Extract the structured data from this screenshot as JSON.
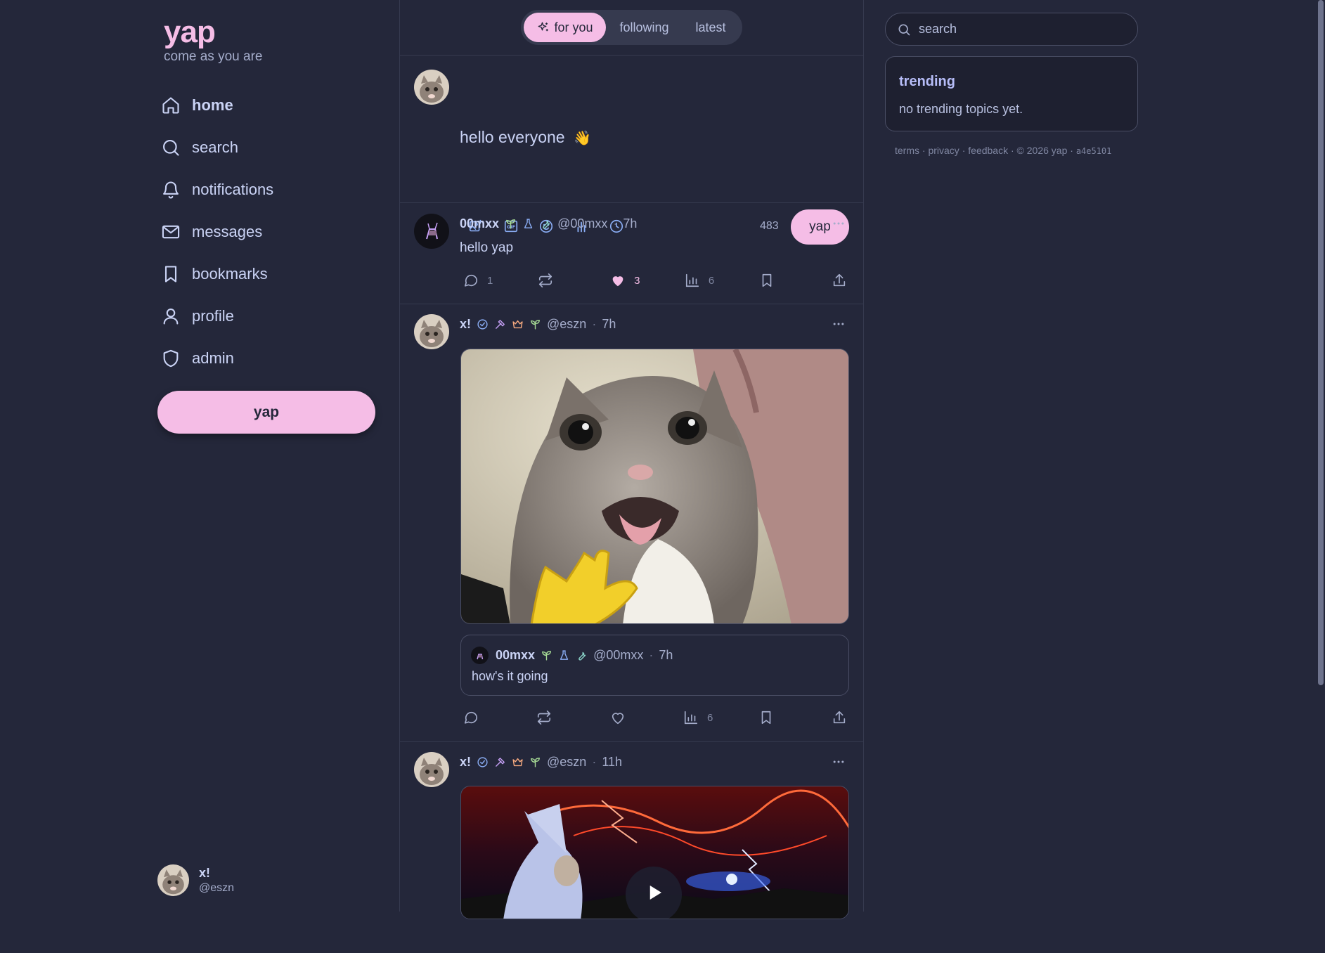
{
  "brand": {
    "logo": "yap",
    "tagline": "come as you are"
  },
  "nav": {
    "items": [
      {
        "label": "home",
        "icon": "home-icon"
      },
      {
        "label": "search",
        "icon": "search-icon"
      },
      {
        "label": "notifications",
        "icon": "bell-icon"
      },
      {
        "label": "messages",
        "icon": "mail-icon"
      },
      {
        "label": "bookmarks",
        "icon": "bookmark-icon"
      },
      {
        "label": "profile",
        "icon": "user-icon"
      },
      {
        "label": "admin",
        "icon": "shield-icon"
      }
    ],
    "yap_button": "yap"
  },
  "me": {
    "name": "x!",
    "handle": "@eszn"
  },
  "feed_tabs": [
    {
      "label": "for you",
      "active": true
    },
    {
      "label": "following",
      "active": false
    },
    {
      "label": "latest",
      "active": false
    }
  ],
  "composer": {
    "text": "hello everyone",
    "emoji": "👋",
    "char_count": "483",
    "submit_label": "yap",
    "tools": [
      "image-add-icon",
      "gif-icon",
      "emoji-icon",
      "poll-icon",
      "schedule-icon"
    ]
  },
  "posts": [
    {
      "name": "00mxx",
      "handle": "@00mxx",
      "sep": "·",
      "time": "7h",
      "body": "hello yap",
      "replies": "1",
      "likes": "3",
      "views": "6",
      "liked": true
    },
    {
      "name": "x!",
      "handle": "@eszn",
      "sep": "·",
      "time": "7h",
      "quote": {
        "name": "00mxx",
        "handle": "@00mxx",
        "sep": "·",
        "time": "7h",
        "body": "how's it going"
      },
      "views": "6"
    },
    {
      "name": "x!",
      "handle": "@eszn",
      "sep": "·",
      "time": "11h"
    }
  ],
  "right": {
    "search_placeholder": "search",
    "trending_title": "trending",
    "trending_empty": "no trending topics yet.",
    "footer": {
      "terms": "terms",
      "privacy": "privacy",
      "feedback": "feedback",
      "copyright": "© 2026 yap",
      "dot": "·",
      "build": "a4e5101"
    }
  },
  "colors": {
    "background": "#24273a",
    "accent": "#f5bde6",
    "text": "#cad3f5",
    "muted": "#a5adcb",
    "badge_green": "#a6da95",
    "badge_blue": "#8aadf4",
    "badge_purple": "#c6a0f6",
    "badge_orange": "#f5a97f"
  }
}
